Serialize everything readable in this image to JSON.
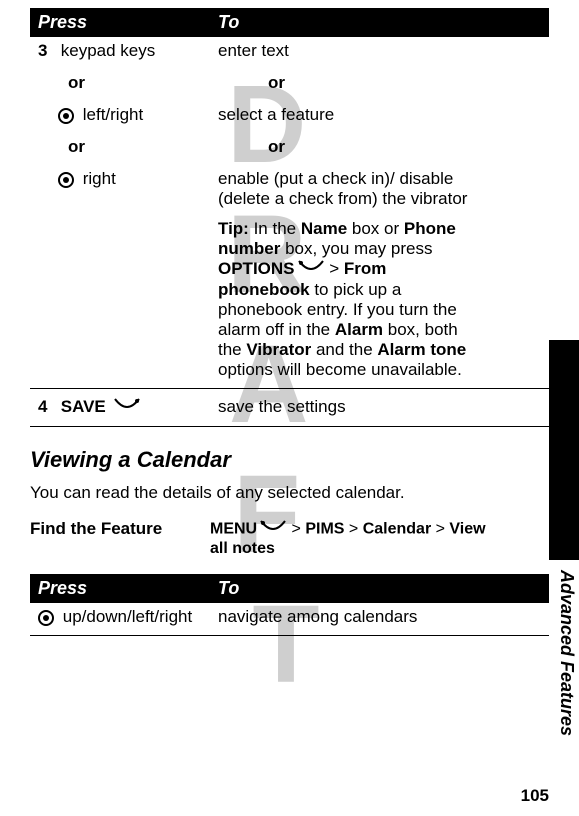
{
  "watermark": "DRAFT",
  "table1": {
    "header_press": "Press",
    "header_to": "To",
    "row1_num": "3",
    "row1_press": "keypad keys",
    "row1_to": "enter text",
    "or": "or",
    "row2_press": "left/right",
    "row2_to": "select a feature",
    "row3_press": "right",
    "row3_to": "enable (put a check in)/ disable (delete a check from) the vibrator",
    "tip_label": "Tip:",
    "tip_text1": " In the ",
    "tip_name": "Name",
    "tip_text2": " box or ",
    "tip_phone": "Phone number",
    "tip_text3": " box, you may press ",
    "tip_options": "OPTIONS",
    "tip_text4": " > ",
    "tip_fromphonebook": "From phonebook",
    "tip_text5": " to pick up a phonebook entry. If you turn the alarm off in the ",
    "tip_alarm": "Alarm",
    "tip_text6": " box, both the ",
    "tip_vibrator": "Vibrator",
    "tip_text7": " and the ",
    "tip_alarmtone": "Alarm tone",
    "tip_text8": " options will become unavailable.",
    "row4_num": "4",
    "row4_press": "SAVE",
    "row4_to": "save the settings"
  },
  "section_heading": "Viewing a Calendar",
  "section_body": "You can read the details of any selected calendar.",
  "find_feature_label": "Find the Feature",
  "find_feature_menu": "MENU",
  "find_feature_sep": " > ",
  "find_feature_pims": "PIMS",
  "find_feature_calendar": "Calendar",
  "find_feature_view": "View all notes",
  "table2": {
    "header_press": "Press",
    "header_to": "To",
    "row1_press": "up/down/left/right",
    "row1_to": "navigate among calendars"
  },
  "side_label": "Advanced Features",
  "page_number": "105"
}
